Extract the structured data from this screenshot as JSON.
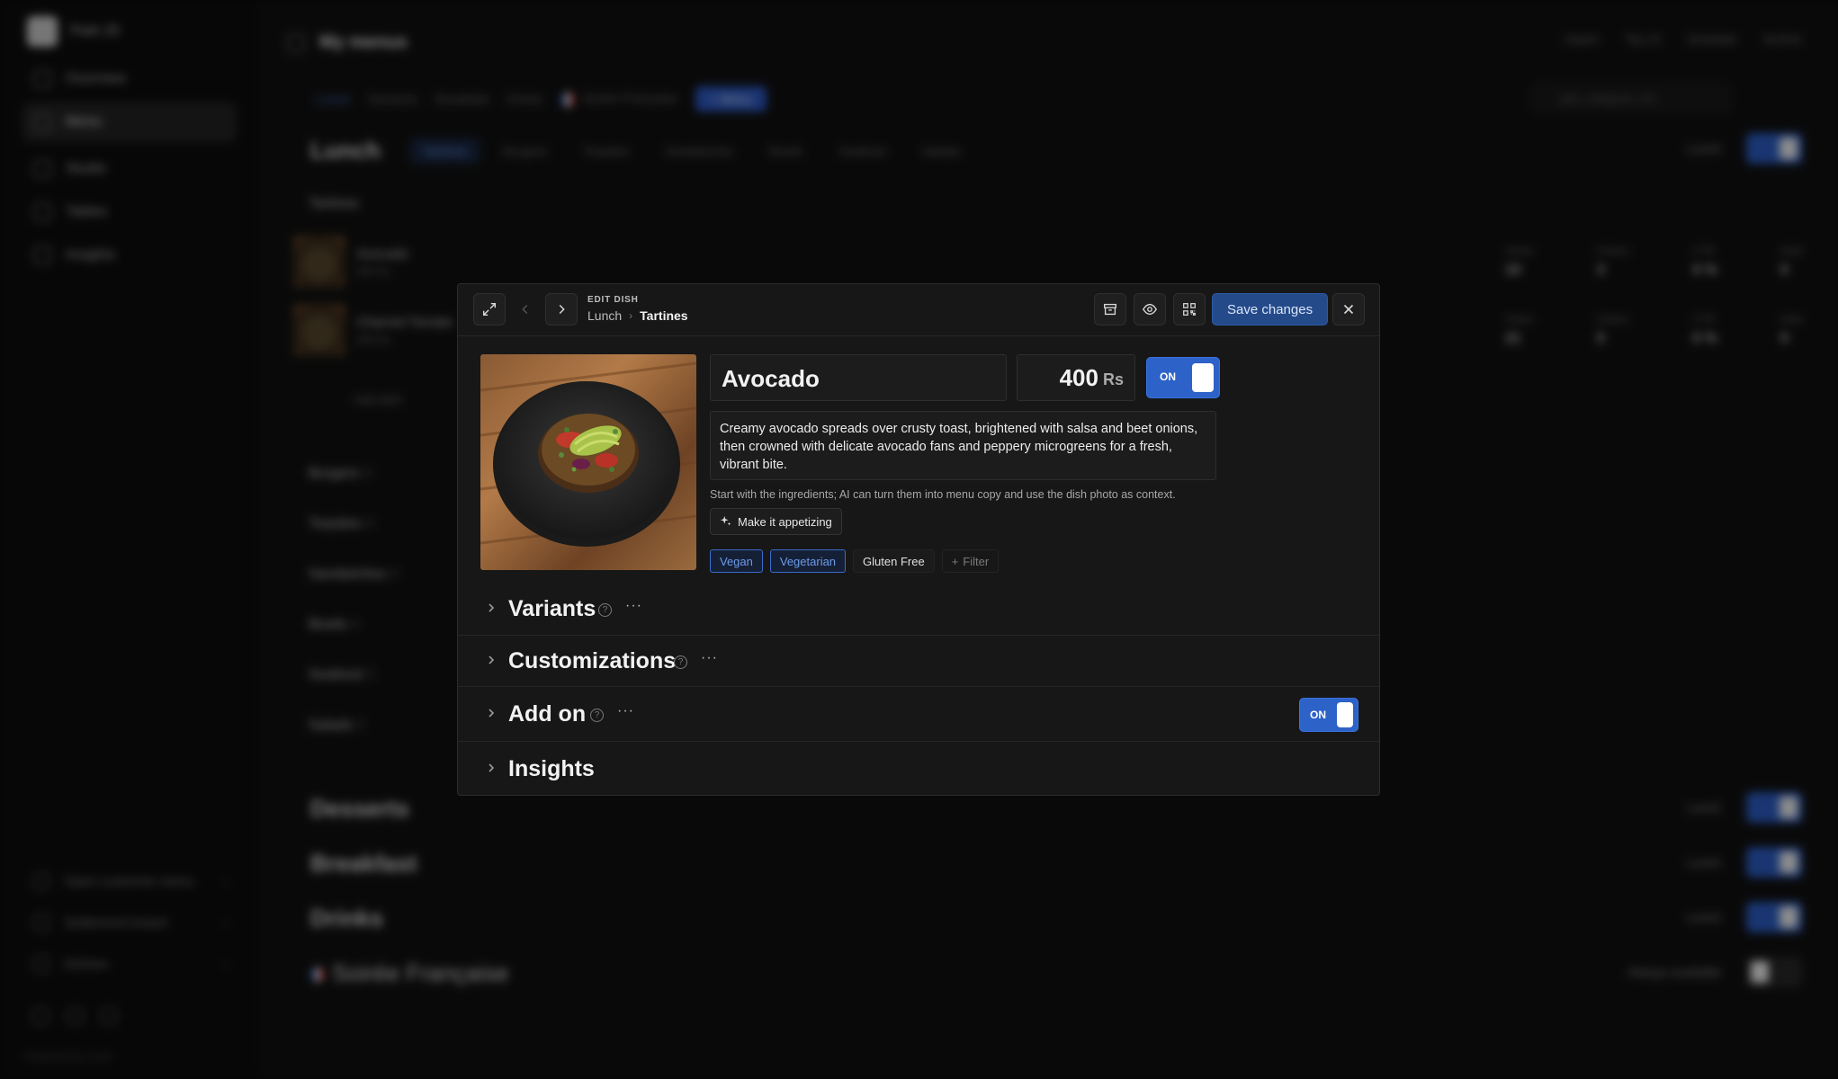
{
  "background": {
    "workspace": "Park 25",
    "nav": [
      {
        "label": "Overview"
      },
      {
        "label": "Menu"
      },
      {
        "label": "Studio"
      },
      {
        "label": "Tables"
      },
      {
        "label": "Insights"
      }
    ],
    "footer_links": [
      {
        "label": "Open customer menu"
      },
      {
        "label": "Settlement board"
      },
      {
        "label": "Kitchen"
      }
    ],
    "powered": "Powered by Lucid",
    "page_title": "My menus",
    "header_actions": [
      "Import",
      "Top 10",
      "Schedule",
      "Archive"
    ],
    "menu_tabs": [
      "Lunch",
      "Desserts",
      "Breakfast",
      "Drinks",
      "Soirée Française"
    ],
    "new_label": "+ Menu",
    "search_placeholder": "plat, catégorie, etc.",
    "section_lunch": "Lunch",
    "category_tabs": [
      "Tartines",
      "Burgers",
      "Toasties",
      "Sandwiches",
      "Bowls",
      "Seafood",
      "Salads"
    ],
    "subsection": "Tartines",
    "dishes": [
      {
        "name": "Avocado",
        "price": "400 Rs",
        "stats": [
          "10",
          "3",
          "0 %",
          "0"
        ]
      },
      {
        "name": "Charred Tomato",
        "price": "400 Rs",
        "stats": [
          "21",
          "0",
          "0 %",
          "0"
        ]
      }
    ],
    "stat_labels": [
      "Views",
      "Orders",
      "CTR",
      "Sold"
    ],
    "add_dish": "Add dish",
    "categories": [
      {
        "name": "Burgers",
        "count": "3"
      },
      {
        "name": "Toasties",
        "count": "4"
      },
      {
        "name": "Sandwiches",
        "count": "4"
      },
      {
        "name": "Bowls",
        "count": "4"
      },
      {
        "name": "Seafood",
        "count": "3"
      },
      {
        "name": "Salads",
        "count": "2"
      }
    ],
    "menus": [
      {
        "name": "Desserts",
        "availability": "Lunch"
      },
      {
        "name": "Breakfast",
        "availability": "Lunch"
      },
      {
        "name": "Drinks",
        "availability": "Lunch"
      },
      {
        "name": "Soirée Française",
        "availability": "Always available"
      }
    ],
    "switch_on": "ON",
    "switch_off": "OFF"
  },
  "modal": {
    "label": "EDIT DISH",
    "breadcrumb": [
      "Lunch",
      "Tartines"
    ],
    "save_label": "Save changes",
    "dish": {
      "name": "Avocado",
      "price": "400",
      "currency": "Rs",
      "active_label": "ON",
      "description": "Creamy avocado spreads over crusty toast, brightened with salsa and beet onions, then crowned with delicate avocado fans and peppery microgreens for a fresh, vibrant bite."
    },
    "ai_hint": "Start with the ingredients; AI can turn them into menu copy and use the dish photo as context.",
    "ai_button": "Make it appetizing",
    "tags": [
      {
        "label": "Vegan",
        "selected": true
      },
      {
        "label": "Vegetarian",
        "selected": true
      },
      {
        "label": "Gluten Free",
        "selected": false
      }
    ],
    "filter_label": "Filter",
    "sections": [
      {
        "title": "Variants"
      },
      {
        "title": "Customizations"
      },
      {
        "title": "Add on",
        "toggle": "ON"
      },
      {
        "title": "Insights"
      }
    ]
  },
  "colors": {
    "accent": "#2d62c8",
    "save_bg": "#244a8a",
    "tag_blue": "#6e9bea"
  }
}
